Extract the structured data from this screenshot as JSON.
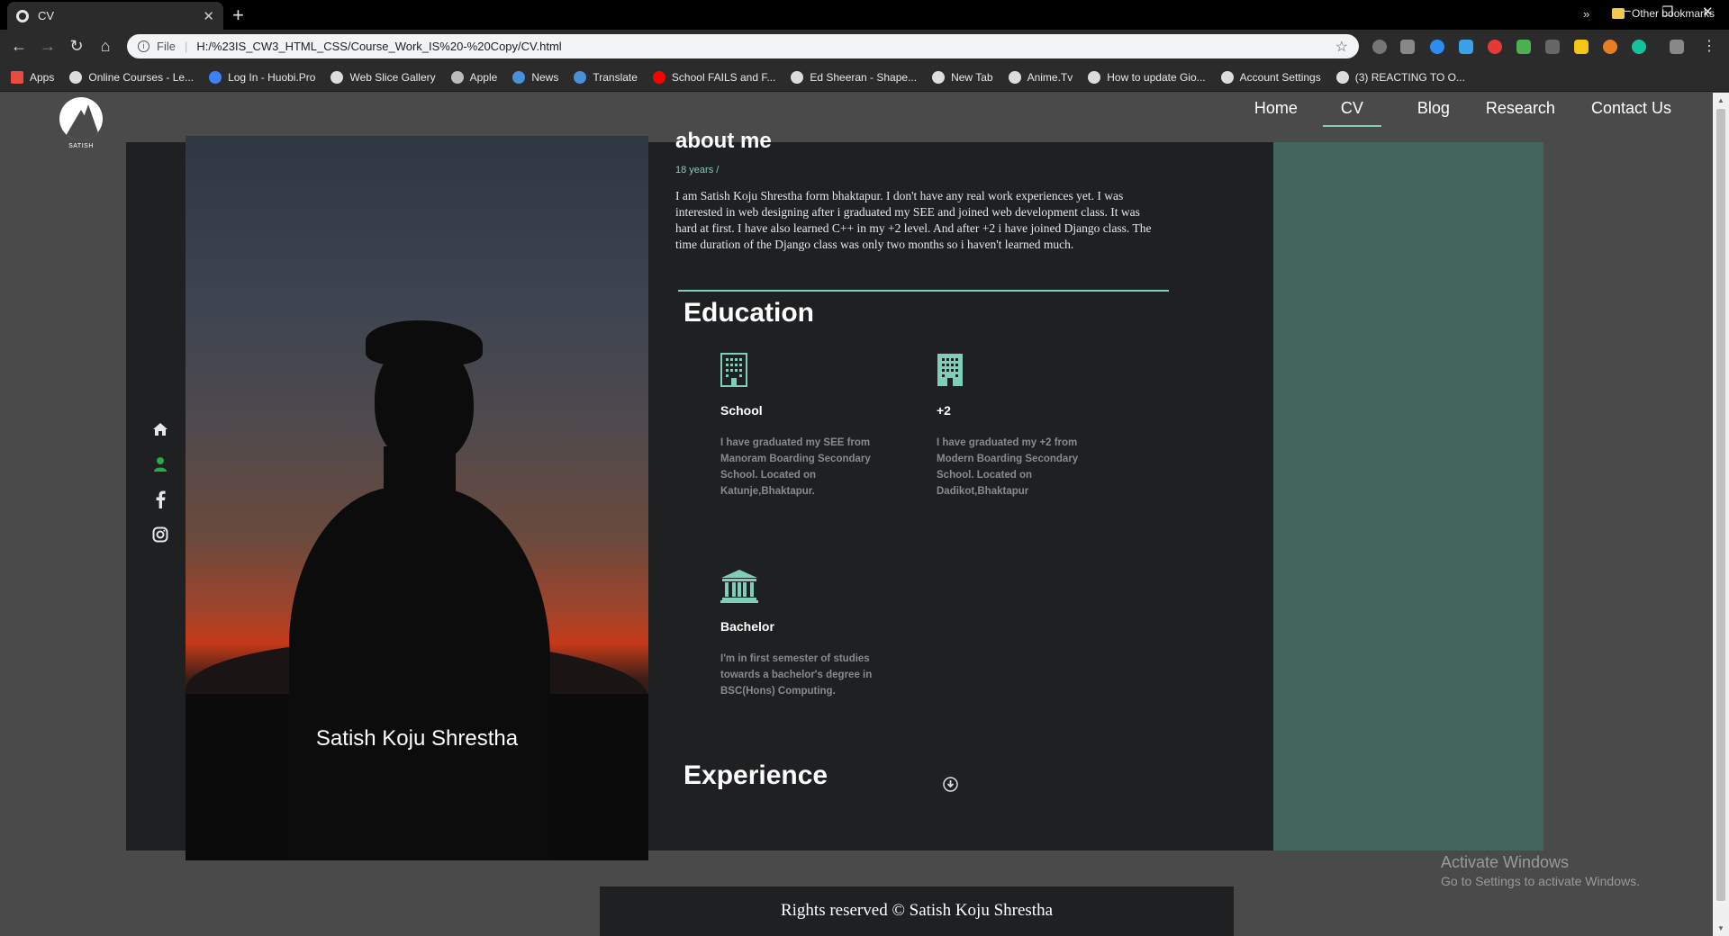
{
  "browser": {
    "tab_title": "CV",
    "url_scheme": "File",
    "url": "H:/%23IS_CW3_HTML_CSS/Course_Work_IS%20-%20Copy/CV.html",
    "bookmarks": [
      {
        "label": "Apps",
        "color": "#e74c3c"
      },
      {
        "label": "Online Courses - Le...",
        "color": "#dddddd"
      },
      {
        "label": "Log In - Huobi.Pro",
        "color": "#3b82f6"
      },
      {
        "label": "Web Slice Gallery",
        "color": "#dddddd"
      },
      {
        "label": "Apple",
        "color": "#bbbbbb"
      },
      {
        "label": "News",
        "color": "#4a90d9"
      },
      {
        "label": "Translate",
        "color": "#4a90d9"
      },
      {
        "label": "School FAILS and F...",
        "color": "#ff0000"
      },
      {
        "label": "Ed Sheeran - Shape...",
        "color": "#dddddd"
      },
      {
        "label": "New Tab",
        "color": "#dddddd"
      },
      {
        "label": "Anime.Tv",
        "color": "#dddddd"
      },
      {
        "label": "How to update Gio...",
        "color": "#dddddd"
      },
      {
        "label": "Account Settings",
        "color": "#dddddd"
      },
      {
        "label": "(3) REACTING TO O...",
        "color": "#dddddd"
      }
    ],
    "more_label": "»",
    "other_bookmarks": "Other bookmarks"
  },
  "site": {
    "logo_text": "SATISH",
    "nav": [
      "Home",
      "CV",
      "Blog",
      "Research",
      "Contact Us"
    ],
    "active_nav": "CV"
  },
  "profile": {
    "name": "Satish Koju Shrestha"
  },
  "about": {
    "title": "about me",
    "age": "18 years /",
    "bio": "I am Satish Koju Shrestha form bhaktapur. I don't have any real work experiences yet. I was interested in web designing after i graduated my SEE and joined web development class. It was hard at first. I have also learned C++ in my +2 level. And after +2 i have joined Django class. The time duration of the Django class was only two months so i haven't learned much."
  },
  "education": {
    "title": "Education",
    "items": [
      {
        "label": "School",
        "desc": "I have graduated my SEE from Manoram Boarding Secondary School. Located on Katunje,Bhaktapur.",
        "icon": "building-icon"
      },
      {
        "label": "+2",
        "desc": "I have graduated my +2 from Modern Boarding Secondary School. Located on Dadikot,Bhaktapur",
        "icon": "building-icon"
      },
      {
        "label": "Bachelor",
        "desc": "I'm in first semester of studies towards a bachelor's degree in BSC(Hons) Computing.",
        "icon": "university-icon"
      }
    ]
  },
  "experience": {
    "title": "Experience"
  },
  "footer": {
    "text": "Rights reserved © Satish Koju Shrestha"
  },
  "watermark": {
    "line1": "Activate Windows",
    "line2": "Go to Settings to activate Windows."
  },
  "colors": {
    "accent": "#7fcfb7",
    "panel_green": "#42665c",
    "card_bg": "#1f2022",
    "page_bg": "#4a4a4a"
  }
}
